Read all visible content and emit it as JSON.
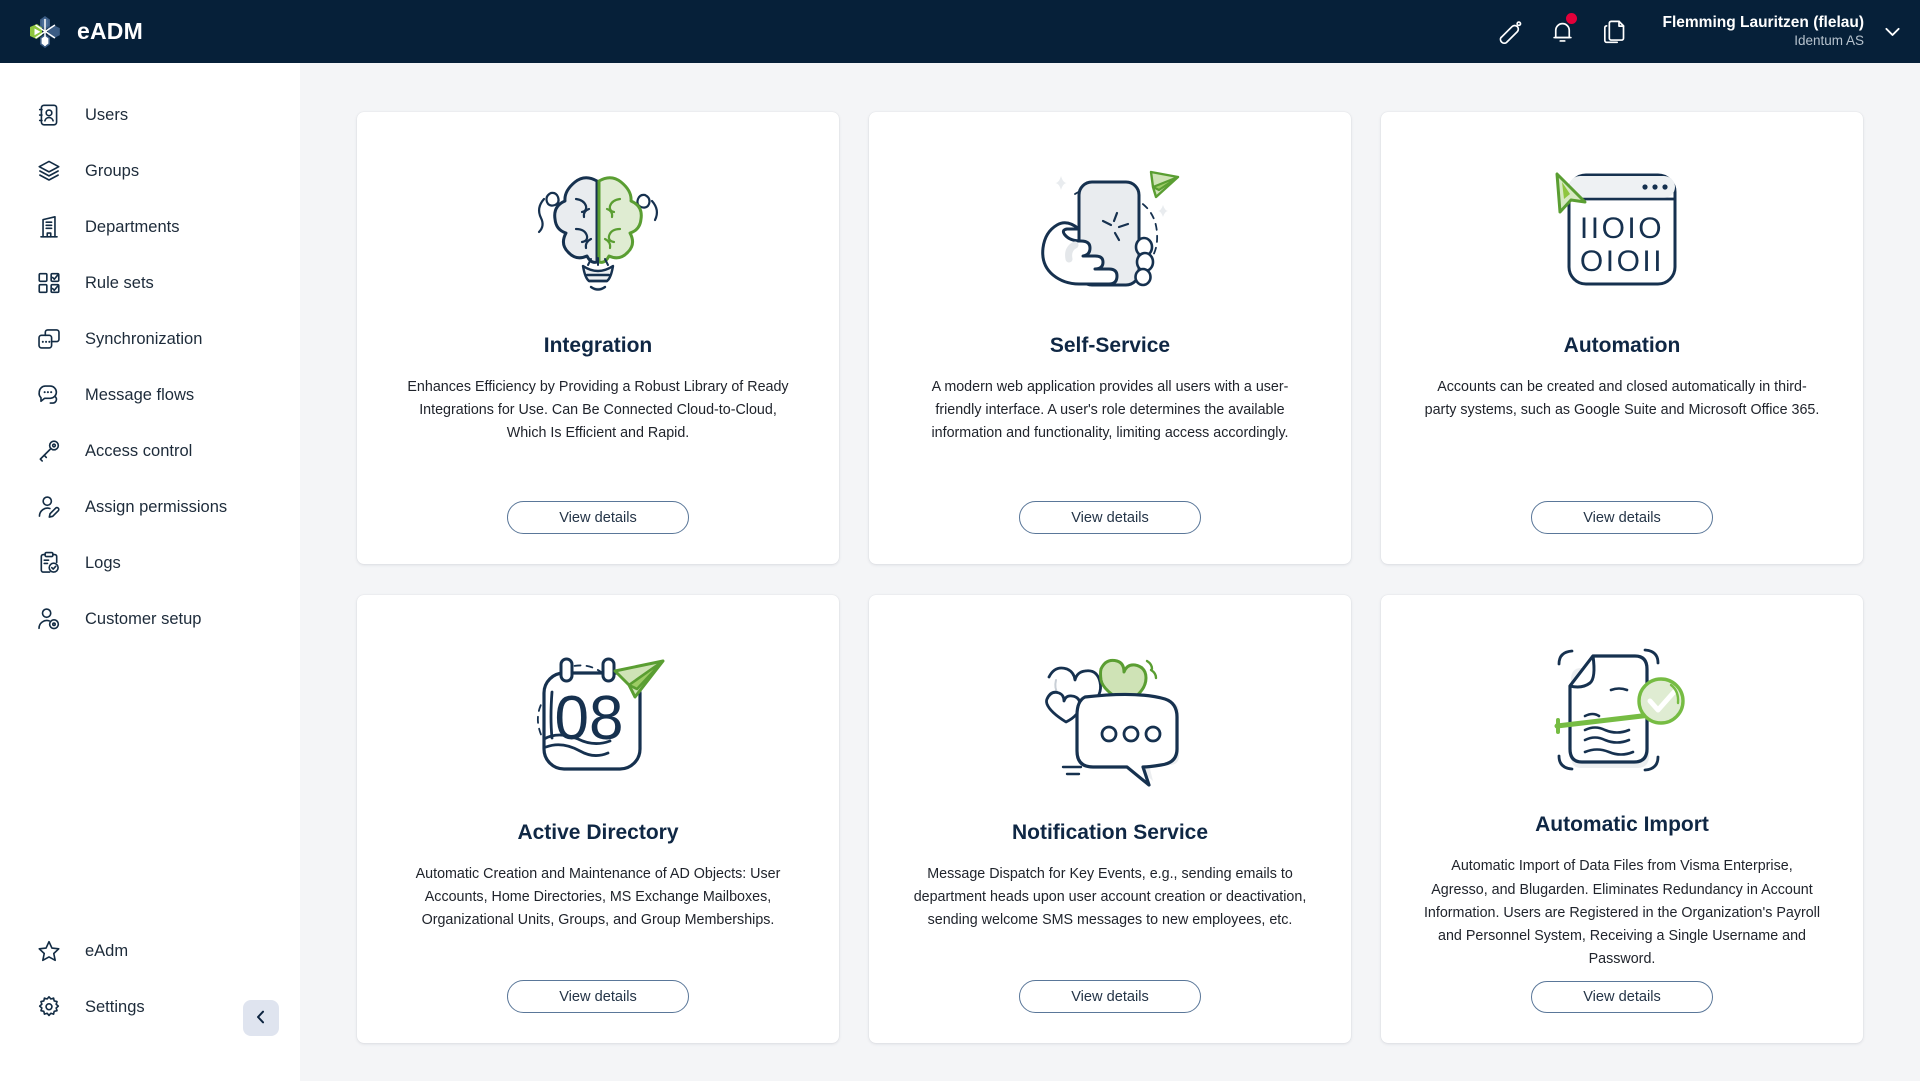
{
  "app": {
    "brand_name": "eADM",
    "logo_icon": "snowflake-logo-icon"
  },
  "topbar": {
    "icons": [
      {
        "name": "edit-pencil-icon",
        "label": "Edit"
      },
      {
        "name": "notification-bell-icon",
        "label": "Notifications",
        "has_badge": true
      },
      {
        "name": "documents-copy-icon",
        "label": "Documents"
      }
    ],
    "user": {
      "name": "Flemming Lauritzen (flelau)",
      "organization": "Identum AS",
      "caret_icon": "chevron-down-icon"
    }
  },
  "sidebar": {
    "items": [
      {
        "label": "Users",
        "icon": "users-contact-icon"
      },
      {
        "label": "Groups",
        "icon": "groups-layers-icon"
      },
      {
        "label": "Departments",
        "icon": "departments-building-icon"
      },
      {
        "label": "Rule sets",
        "icon": "rule-sets-checklist-icon"
      },
      {
        "label": "Synchronization",
        "icon": "synchronization-icon"
      },
      {
        "label": "Message flows",
        "icon": "message-flows-chat-icon"
      },
      {
        "label": "Access control",
        "icon": "access-control-key-icon"
      },
      {
        "label": "Assign permissions",
        "icon": "assign-permissions-user-edit-icon"
      },
      {
        "label": "Logs",
        "icon": "logs-clipboard-check-icon"
      },
      {
        "label": "Customer setup",
        "icon": "customer-setup-user-gear-icon"
      }
    ],
    "bottom_items": [
      {
        "label": "eAdm",
        "icon": "star-icon"
      },
      {
        "label": "Settings",
        "icon": "gear-icon"
      }
    ],
    "collapse_icon": "chevron-left-icon"
  },
  "main": {
    "cards": [
      {
        "title": "Integration",
        "description": "Enhances Efficiency by Providing a Robust Library of Ready Integrations for Use. Can Be Connected Cloud-to-Cloud, Which Is Efficient and Rapid.",
        "button_label": "View details",
        "illustration": "brain-lightbulb-illustration"
      },
      {
        "title": "Self-Service",
        "description": "A modern web application provides all users with a user-friendly interface. A user's role determines the available information and functionality, limiting access accordingly.",
        "button_label": "View details",
        "illustration": "hand-holding-phone-illustration"
      },
      {
        "title": "Automation",
        "description": "Accounts can be created and closed automatically in third-party systems, such as Google Suite and Microsoft Office 365.",
        "button_label": "View details",
        "illustration": "browser-binary-cursor-illustration"
      },
      {
        "title": "Active Directory",
        "description": "Automatic Creation and Maintenance of AD Objects: User Accounts, Home Directories, MS Exchange Mailboxes, Organizational Units, Groups, and Group Memberships.",
        "button_label": "View details",
        "illustration": "calendar-08-paperplane-illustration"
      },
      {
        "title": "Notification Service",
        "description": "Message Dispatch for Key Events, e.g., sending emails to department heads upon user account creation or deactivation, sending welcome SMS messages to new employees, etc.",
        "button_label": "View details",
        "illustration": "speech-bubble-hearts-illustration"
      },
      {
        "title": "Automatic Import",
        "description": "Automatic Import of Data Files from Visma Enterprise, Agresso, and Blugarden. Eliminates Redundancy in Account Information. Users are Registered in the Organization's Payroll and Personnel System, Receiving a Single Username and Password.",
        "button_label": "View details",
        "illustration": "document-check-scan-illustration"
      }
    ],
    "illustration_text": {
      "calendar_day": "08",
      "binary_row1": "IIOIO",
      "binary_row2": "OIOII"
    }
  },
  "colors": {
    "topbar_bg": "#062039",
    "page_bg": "#f4f5f7",
    "accent_green": "#76bc43",
    "ink": "#1d2b3a",
    "badge_red": "#e3003a",
    "button_border": "#5a7799"
  }
}
